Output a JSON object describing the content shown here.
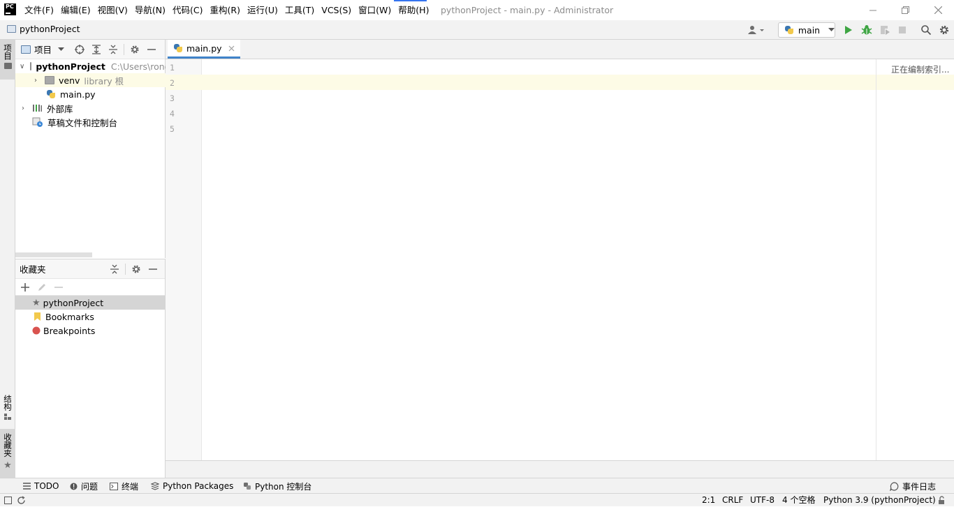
{
  "menu": [
    "文件(F)",
    "编辑(E)",
    "视图(V)",
    "导航(N)",
    "代码(C)",
    "重构(R)",
    "运行(U)",
    "工具(T)",
    "VCS(S)",
    "窗口(W)",
    "帮助(H)"
  ],
  "window_title": "pythonProject - main.py - Administrator",
  "app_logo": "PC",
  "nav": {
    "project": "pythonProject",
    "run_config": "main"
  },
  "left_stripe": {
    "project": "项目",
    "structure": "结构",
    "favorites": "收藏夹"
  },
  "project_panel": {
    "view_label": "项目",
    "tree": {
      "root_name": "pythonProject",
      "root_path": "C:\\Users\\rong",
      "venv_name": "venv",
      "venv_tag": "library 根",
      "main_file": "main.py",
      "external_libs": "外部库",
      "scratches": "草稿文件和控制台"
    }
  },
  "favorites_panel": {
    "title": "收藏夹",
    "items": [
      "pythonProject",
      "Bookmarks",
      "Breakpoints"
    ]
  },
  "editor": {
    "tab": "main.py",
    "line_numbers": [
      "1",
      "2",
      "3",
      "4",
      "5"
    ],
    "indexing": "正在编制索引..."
  },
  "tool_windows": [
    "TODO",
    "问题",
    "终端",
    "Python Packages",
    "Python 控制台"
  ],
  "event_log": "事件日志",
  "status": {
    "position": "2:1",
    "line_sep": "CRLF",
    "encoding": "UTF-8",
    "indent": "4 个空格",
    "interpreter": "Python 3.9 (pythonProject)"
  },
  "colors": {
    "accent": "#4083c9",
    "run": "#3ea543",
    "breakpoint": "#d9534f",
    "bookmark": "#f2c94c"
  }
}
